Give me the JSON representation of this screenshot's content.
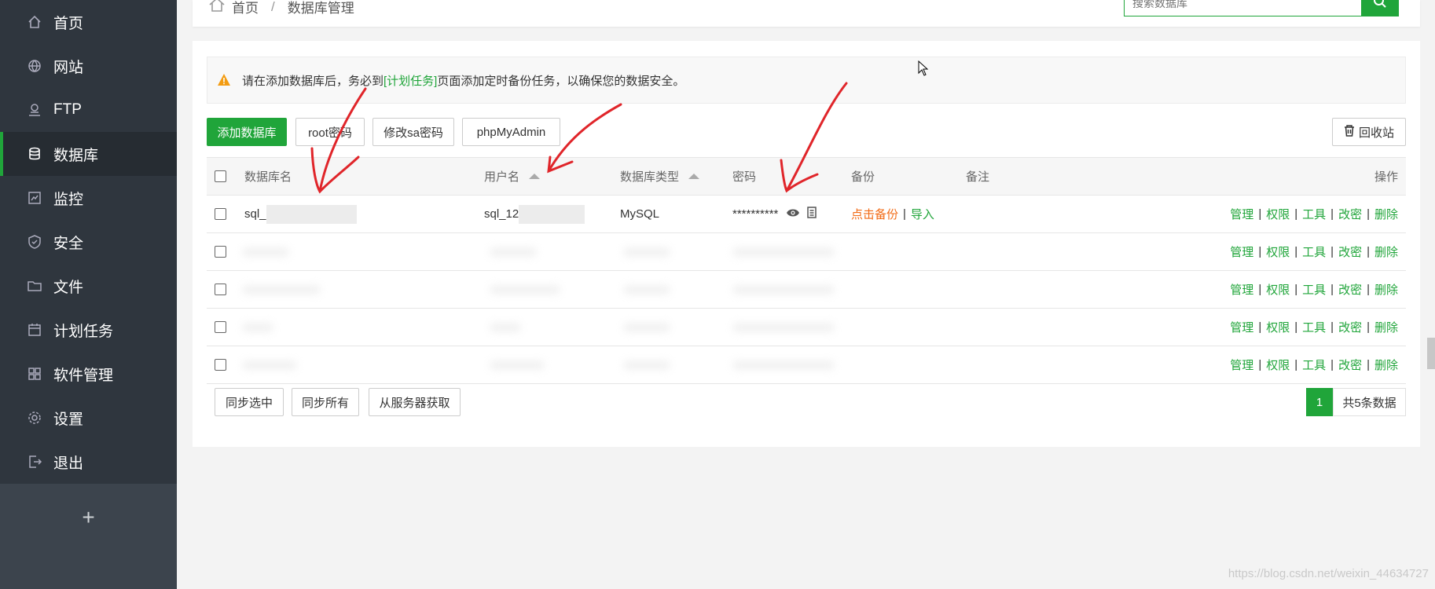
{
  "sidebar": {
    "items": [
      {
        "label": "首页",
        "icon": "home-icon"
      },
      {
        "label": "网站",
        "icon": "globe-icon"
      },
      {
        "label": "FTP",
        "icon": "ftp-icon"
      },
      {
        "label": "数据库",
        "icon": "database-icon",
        "active": true
      },
      {
        "label": "监控",
        "icon": "monitor-icon"
      },
      {
        "label": "安全",
        "icon": "shield-icon"
      },
      {
        "label": "文件",
        "icon": "folder-icon"
      },
      {
        "label": "计划任务",
        "icon": "calendar-icon"
      },
      {
        "label": "软件管理",
        "icon": "apps-icon"
      },
      {
        "label": "设置",
        "icon": "gear-icon"
      },
      {
        "label": "退出",
        "icon": "logout-icon"
      }
    ],
    "add_label": "+"
  },
  "header": {
    "breadcrumb_home": "首页",
    "breadcrumb_sep": "/",
    "breadcrumb_current": "数据库管理",
    "search_placeholder": "搜索数据库"
  },
  "alert": {
    "text_before": "请在添加数据库后，务必到",
    "link": "[计划任务]",
    "text_after": "页面添加定时备份任务，以确保您的数据安全。"
  },
  "toolbar": {
    "add_db": "添加数据库",
    "root_pwd": "root密码",
    "sa_pwd": "修改sa密码",
    "phpmyadmin": "phpMyAdmin",
    "recycle": "回收站"
  },
  "table": {
    "headers": {
      "name": "数据库名",
      "user": "用户名",
      "type": "数据库类型",
      "password": "密码",
      "backup": "备份",
      "remark": "备注",
      "actions": "操作"
    },
    "first_row": {
      "name": "sql_",
      "user": "sql_12",
      "type": "MySQL",
      "password": "**********",
      "backup": "点击备份",
      "import": "导入"
    },
    "actions": [
      "管理",
      "权限",
      "工具",
      "改密",
      "删除"
    ],
    "action_sep": "|"
  },
  "footer": {
    "sync_selected": "同步选中",
    "sync_all": "同步所有",
    "fetch_server": "从服务器获取",
    "page": "1",
    "total": "共5条数据"
  },
  "watermark": "https://blog.csdn.net/weixin_44634727",
  "colors": {
    "accent": "#20a53a",
    "sidebar": "#3c444d",
    "orange": "#f26b16",
    "annotation": "#e0252a"
  }
}
